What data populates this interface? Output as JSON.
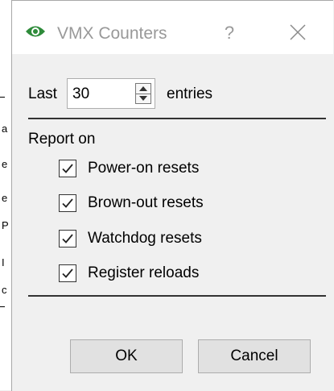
{
  "window": {
    "title": "VMX Counters",
    "help_glyph": "?",
    "icon": "eye-icon",
    "icon_color": "#2e8b3a"
  },
  "history": {
    "prefix_label": "Last",
    "count_value": "30",
    "suffix_label": "entries"
  },
  "report": {
    "heading": "Report on",
    "options": [
      {
        "label": "Power-on resets",
        "checked": true
      },
      {
        "label": "Brown-out resets",
        "checked": true
      },
      {
        "label": "Watchdog resets",
        "checked": true
      },
      {
        "label": "Register reloads",
        "checked": true
      }
    ]
  },
  "buttons": {
    "ok_label": "OK",
    "cancel_label": "Cancel"
  },
  "background_fragments": [
    "a",
    "e",
    "e",
    "P",
    "I",
    "c"
  ]
}
